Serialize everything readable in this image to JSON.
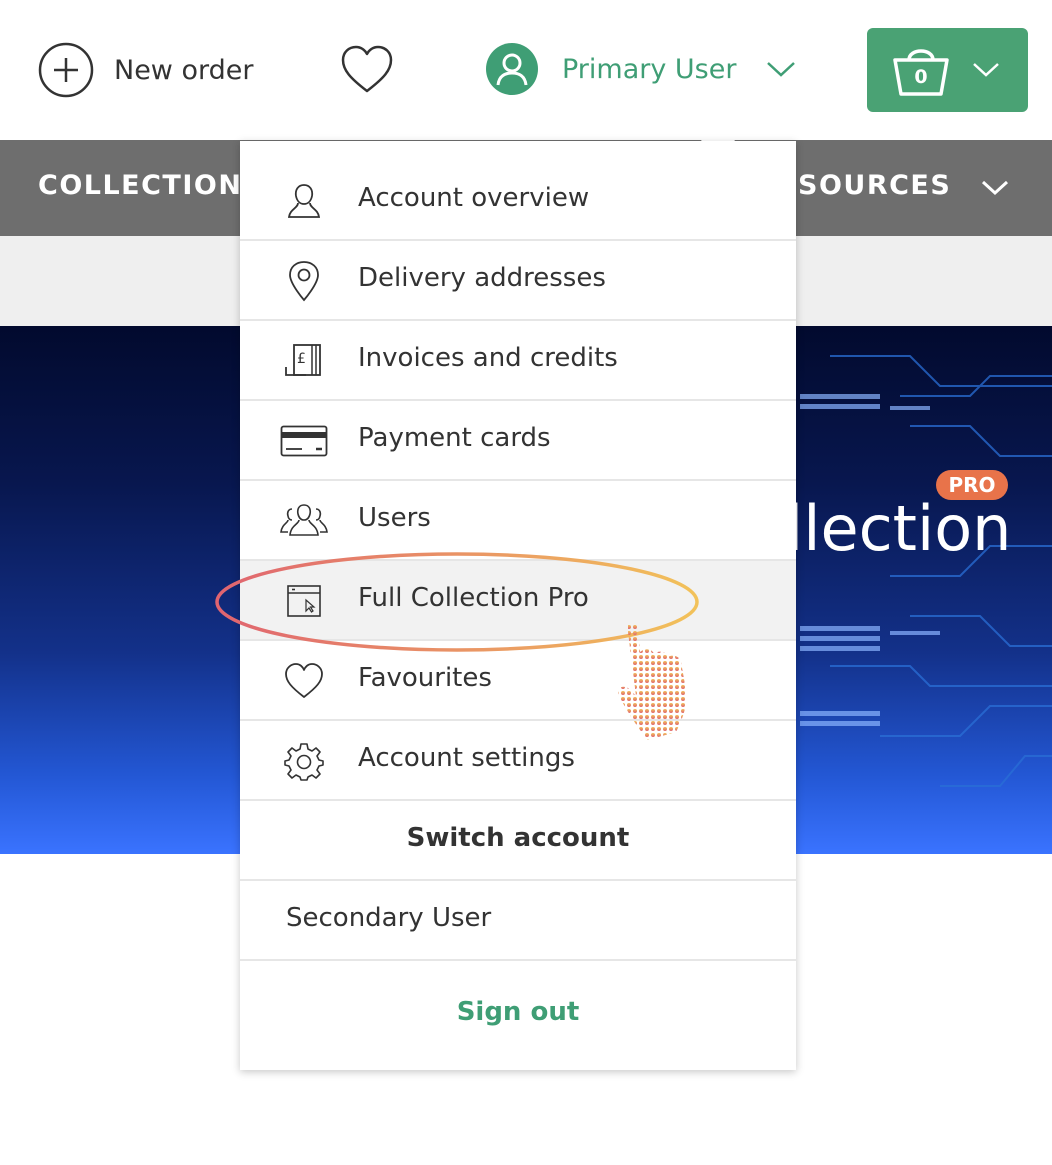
{
  "header": {
    "new_order_label": "New order",
    "user_name": "Primary User",
    "cart_count": "0"
  },
  "nav": {
    "left_label": "COLLECTION",
    "right_label": "SOURCES"
  },
  "hero": {
    "title": "llection",
    "badge": "PRO"
  },
  "account_menu": {
    "items": [
      {
        "label": "Account overview",
        "icon": "user-outline-icon"
      },
      {
        "label": "Delivery addresses",
        "icon": "location-pin-icon"
      },
      {
        "label": "Invoices and credits",
        "icon": "invoice-icon"
      },
      {
        "label": "Payment cards",
        "icon": "credit-card-icon"
      },
      {
        "label": "Users",
        "icon": "users-group-icon"
      },
      {
        "label": "Full Collection Pro",
        "icon": "browser-window-icon",
        "highlighted": true
      },
      {
        "label": "Favourites",
        "icon": "heart-icon"
      },
      {
        "label": "Account settings",
        "icon": "gear-icon"
      }
    ],
    "switch_account_label": "Switch account",
    "secondary_user_label": "Secondary User",
    "sign_out_label": "Sign out"
  },
  "colors": {
    "brand_green": "#3f9e75",
    "cart_green": "#4aa274",
    "nav_grey": "#6e6e6e",
    "highlight_gradient_start": "#e06470",
    "highlight_gradient_end": "#f2c25a"
  }
}
